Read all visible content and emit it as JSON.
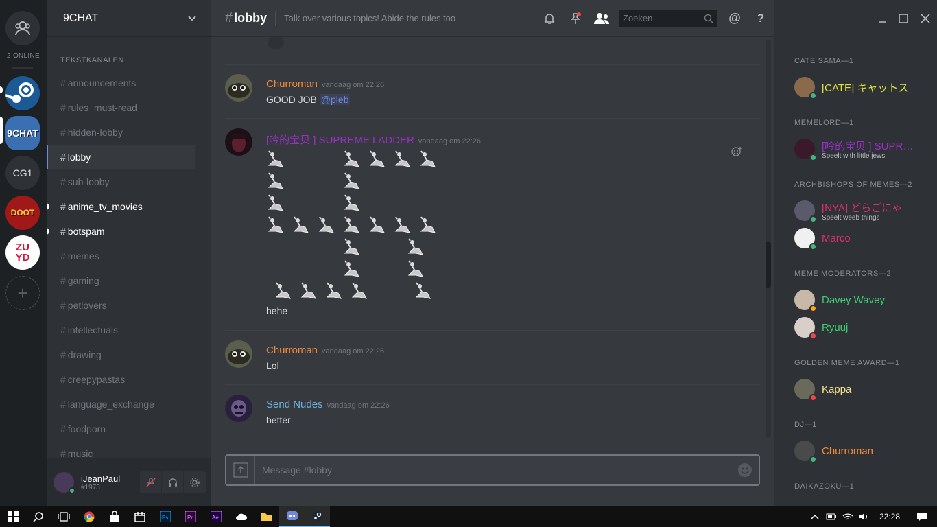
{
  "rail": {
    "online_label": "2 ONLINE",
    "servers": [
      {
        "name": "Steam",
        "label": ""
      },
      {
        "name": "9CHAT",
        "label": "9CHAT"
      },
      {
        "name": "CG1",
        "label": "CG1"
      },
      {
        "name": "Doom",
        "label": "DOOT"
      },
      {
        "name": "ZUYD",
        "label": "ZU YD"
      }
    ]
  },
  "sidebar": {
    "server_name": "9CHAT",
    "category": "TEKSTKANALEN",
    "channels": [
      {
        "name": "announcements",
        "state": "muted"
      },
      {
        "name": "rules_must-read",
        "state": "muted"
      },
      {
        "name": "hidden-lobby",
        "state": "muted"
      },
      {
        "name": "lobby",
        "state": "active"
      },
      {
        "name": "sub-lobby",
        "state": "muted"
      },
      {
        "name": "anime_tv_movies",
        "state": "unread"
      },
      {
        "name": "botspam",
        "state": "unread"
      },
      {
        "name": "memes",
        "state": "muted"
      },
      {
        "name": "gaming",
        "state": "muted"
      },
      {
        "name": "petlovers",
        "state": "muted"
      },
      {
        "name": "intellectuals",
        "state": "muted"
      },
      {
        "name": "drawing",
        "state": "muted"
      },
      {
        "name": "creepypastas",
        "state": "muted"
      },
      {
        "name": "language_exchange",
        "state": "muted"
      },
      {
        "name": "foodporn",
        "state": "muted"
      },
      {
        "name": "music",
        "state": "muted"
      }
    ],
    "hash": "#"
  },
  "user": {
    "name": "iJeanPaul",
    "tag": "#1973"
  },
  "header": {
    "hash": "#",
    "channel": "lobby",
    "topic": "Talk over various topics! Abide the rules too",
    "search_placeholder": "Zoeken"
  },
  "messages": [
    {
      "author": "Churroman",
      "color": "#f08a3c",
      "time": "vandaag om 22:26",
      "text": "GOOD JOB ",
      "mention": "@pleb"
    },
    {
      "author": "[吟的宝贝 ] SUPREME LADDER",
      "color": "#9b30c8",
      "time": "vandaag om 22:26",
      "text": "hehe"
    },
    {
      "author": "Churroman",
      "color": "#f08a3c",
      "time": "vandaag om 22:26",
      "text": "Lol"
    },
    {
      "author": "Send Nudes",
      "color": "#6fb2dc",
      "time": "vandaag om 22:26",
      "text": "better"
    }
  ],
  "composer": {
    "placeholder": "Message #lobby"
  },
  "members": {
    "groups": [
      {
        "title": "CATE SAMA—1",
        "members": [
          {
            "name": "[CATE] キャットス",
            "color": "#e1e33a",
            "status": "online",
            "sub": ""
          }
        ]
      },
      {
        "title": "MEMELORD—1",
        "members": [
          {
            "name": "[吟的宝贝 ] SUPREME",
            "color": "#9b30c8",
            "status": "online",
            "sub": "Speelt with little jews"
          }
        ]
      },
      {
        "title": "ARCHBISHOPS OF MEMES—2",
        "members": [
          {
            "name": "[NYA] どらごにゃ",
            "color": "#e0306e",
            "status": "online",
            "sub": "Speelt weeb things"
          },
          {
            "name": "Marco",
            "color": "#e0306e",
            "status": "online",
            "sub": ""
          }
        ]
      },
      {
        "title": "MEME MODERATORS—2",
        "members": [
          {
            "name": "Davey Wavey",
            "color": "#3ecf6e",
            "status": "idle",
            "sub": ""
          },
          {
            "name": "Ryuuj",
            "color": "#3ecf6e",
            "status": "dnd",
            "sub": ""
          }
        ]
      },
      {
        "title": "GOLDEN MEME AWARD—1",
        "members": [
          {
            "name": "Kappa",
            "color": "#f5e38a",
            "status": "dnd",
            "sub": ""
          }
        ]
      },
      {
        "title": "DJ—1",
        "members": [
          {
            "name": "Churroman",
            "color": "#f08a3c",
            "status": "online",
            "sub": ""
          }
        ]
      },
      {
        "title": "DAIKAZOKU—1",
        "members": []
      }
    ]
  },
  "taskbar": {
    "clock": "22:28"
  },
  "colors": {
    "accent": "#7289da",
    "online": "#43b581",
    "idle": "#faa61a",
    "dnd": "#f04747"
  }
}
